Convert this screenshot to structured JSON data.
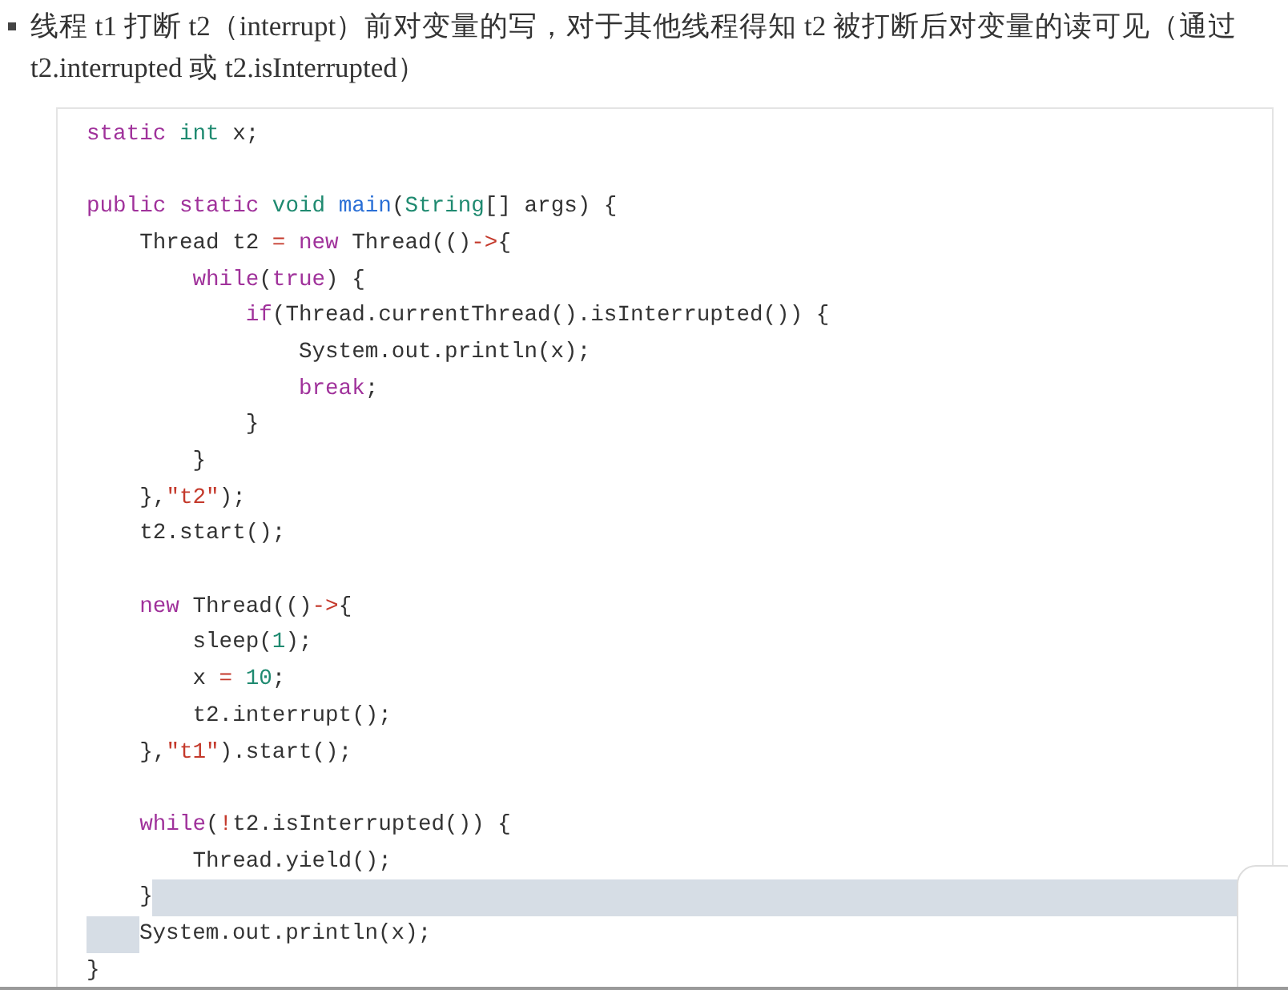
{
  "bullet_text": "线程 t1 打断 t2（interrupt）前对变量的写，对于其他线程得知 t2 被打断后对变量的读可见（通过 t2.interrupted 或 t2.isInterrupted）",
  "code_lines": [
    {
      "kind": "code",
      "tokens": [
        {
          "text": "static ",
          "kind": "kw"
        },
        {
          "text": "int",
          "kind": "type"
        },
        {
          "text": " x;",
          "kind": "plain"
        }
      ]
    },
    {
      "kind": "blank"
    },
    {
      "kind": "code",
      "tokens": [
        {
          "text": "public static ",
          "kind": "kw"
        },
        {
          "text": "void ",
          "kind": "type"
        },
        {
          "text": "main",
          "kind": "fn"
        },
        {
          "text": "(",
          "kind": "plain"
        },
        {
          "text": "String",
          "kind": "type"
        },
        {
          "text": "[] args) {",
          "kind": "plain"
        }
      ]
    },
    {
      "kind": "code",
      "tokens": [
        {
          "text": "    Thread t2 ",
          "kind": "plain"
        },
        {
          "text": "=",
          "kind": "op"
        },
        {
          "text": " new",
          "kind": "kw"
        },
        {
          "text": " Thread(()",
          "kind": "plain"
        },
        {
          "text": "->",
          "kind": "op"
        },
        {
          "text": "{",
          "kind": "plain"
        }
      ]
    },
    {
      "kind": "code",
      "tokens": [
        {
          "text": "        while",
          "kind": "kw"
        },
        {
          "text": "(",
          "kind": "plain"
        },
        {
          "text": "true",
          "kind": "kw"
        },
        {
          "text": ") {",
          "kind": "plain"
        }
      ]
    },
    {
      "kind": "code",
      "tokens": [
        {
          "text": "            if",
          "kind": "kw"
        },
        {
          "text": "(Thread.currentThread().isInterrupted()) {",
          "kind": "plain"
        }
      ]
    },
    {
      "kind": "code",
      "tokens": [
        {
          "text": "                System.out.println(x);",
          "kind": "plain"
        }
      ]
    },
    {
      "kind": "code",
      "tokens": [
        {
          "text": "                break",
          "kind": "kw"
        },
        {
          "text": ";",
          "kind": "plain"
        }
      ]
    },
    {
      "kind": "code",
      "tokens": [
        {
          "text": "            }",
          "kind": "plain"
        }
      ]
    },
    {
      "kind": "code",
      "tokens": [
        {
          "text": "        }",
          "kind": "plain"
        }
      ]
    },
    {
      "kind": "code",
      "tokens": [
        {
          "text": "    },",
          "kind": "plain"
        },
        {
          "text": "\"t2\"",
          "kind": "str"
        },
        {
          "text": ");",
          "kind": "plain"
        }
      ]
    },
    {
      "kind": "code",
      "tokens": [
        {
          "text": "    t2.start();",
          "kind": "plain"
        }
      ]
    },
    {
      "kind": "blank"
    },
    {
      "kind": "code",
      "tokens": [
        {
          "text": "    new",
          "kind": "kw"
        },
        {
          "text": " Thread(()",
          "kind": "plain"
        },
        {
          "text": "->",
          "kind": "op"
        },
        {
          "text": "{",
          "kind": "plain"
        }
      ]
    },
    {
      "kind": "code",
      "tokens": [
        {
          "text": "        sleep(",
          "kind": "plain"
        },
        {
          "text": "1",
          "kind": "num"
        },
        {
          "text": ");",
          "kind": "plain"
        }
      ]
    },
    {
      "kind": "code",
      "tokens": [
        {
          "text": "        x ",
          "kind": "plain"
        },
        {
          "text": "=",
          "kind": "op"
        },
        {
          "text": " 10",
          "kind": "num"
        },
        {
          "text": ";",
          "kind": "plain"
        }
      ]
    },
    {
      "kind": "code",
      "tokens": [
        {
          "text": "        t2.interrupt();",
          "kind": "plain"
        }
      ]
    },
    {
      "kind": "code",
      "tokens": [
        {
          "text": "    },",
          "kind": "plain"
        },
        {
          "text": "\"t1\"",
          "kind": "str"
        },
        {
          "text": ").start();",
          "kind": "plain"
        }
      ]
    },
    {
      "kind": "blank"
    },
    {
      "kind": "code",
      "tokens": [
        {
          "text": "    while",
          "kind": "kw"
        },
        {
          "text": "(",
          "kind": "plain"
        },
        {
          "text": "!",
          "kind": "op"
        },
        {
          "text": "t2.isInterrupted()) {",
          "kind": "plain"
        }
      ]
    },
    {
      "kind": "code",
      "tokens": [
        {
          "text": "        Thread.yield();",
          "kind": "plain"
        }
      ]
    },
    {
      "kind": "code",
      "tokens": [
        {
          "text": "    }",
          "kind": "plain"
        }
      ],
      "selection_tail": true
    },
    {
      "kind": "code",
      "tokens": [
        {
          "text": "    System.out.println(x);",
          "kind": "plain"
        }
      ],
      "selection_head": true
    },
    {
      "kind": "code",
      "tokens": [
        {
          "text": "}",
          "kind": "plain"
        }
      ]
    }
  ]
}
